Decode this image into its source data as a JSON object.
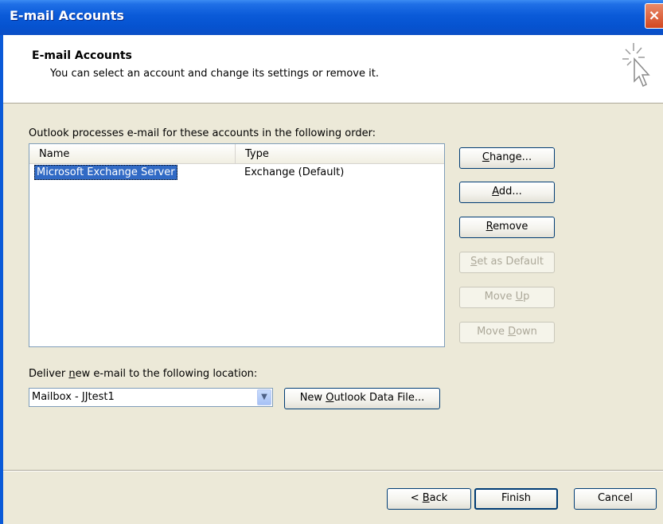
{
  "window": {
    "title": "E-mail Accounts",
    "close_icon": "×"
  },
  "header": {
    "title": "E-mail Accounts",
    "subtitle": "You can select an account and change its settings or remove it."
  },
  "main": {
    "instruction": "Outlook processes e-mail for these accounts in the following order:",
    "columns": [
      "Name",
      "Type"
    ],
    "accounts": [
      {
        "name": "Microsoft Exchange Server",
        "type": "Exchange (Default)",
        "selected": true
      }
    ]
  },
  "buttons": {
    "change": {
      "pre": "",
      "key": "C",
      "post": "hange..."
    },
    "add": {
      "pre": "",
      "key": "A",
      "post": "dd..."
    },
    "remove": {
      "pre": "",
      "key": "R",
      "post": "emove"
    },
    "set_default": {
      "pre": "",
      "key": "S",
      "post": "et as Default"
    },
    "move_up": {
      "pre": "Move ",
      "key": "U",
      "post": "p"
    },
    "move_down": {
      "pre": "Move ",
      "key": "D",
      "post": "own"
    }
  },
  "deliver": {
    "label": {
      "pre": "Deliver ",
      "key": "n",
      "post": "ew e-mail to the following location:"
    },
    "selected": "Mailbox - JJtest1",
    "new_file_button": {
      "pre": "New ",
      "key": "O",
      "post": "utlook Data File..."
    }
  },
  "footer": {
    "back": {
      "pre": "< ",
      "key": "B",
      "post": "ack"
    },
    "finish": "Finish",
    "cancel": "Cancel"
  },
  "colors": {
    "titlebar": "#0a5ad8",
    "selection": "#316ac5",
    "dialog_bg": "#ece9d8"
  }
}
